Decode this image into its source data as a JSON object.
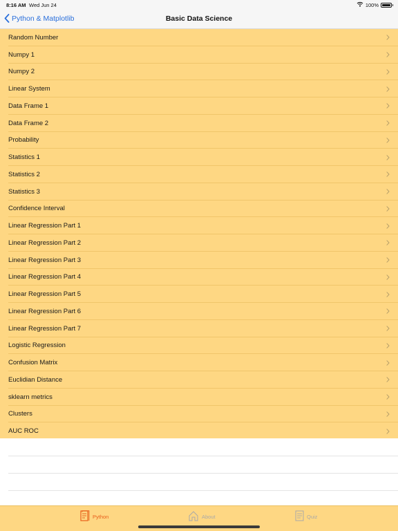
{
  "status_bar": {
    "time": "8:16 AM",
    "date": "Wed Jun 24",
    "battery": "100%",
    "battery_level": 1.0
  },
  "nav": {
    "back_label": "Python & Matplotlib",
    "title": "Basic Data Science"
  },
  "list": {
    "items": [
      {
        "label": "Random Number"
      },
      {
        "label": "Numpy 1"
      },
      {
        "label": "Numpy 2"
      },
      {
        "label": "Linear System"
      },
      {
        "label": "Data Frame 1"
      },
      {
        "label": "Data Frame 2"
      },
      {
        "label": "Probability"
      },
      {
        "label": "Statistics 1"
      },
      {
        "label": "Statistics 2"
      },
      {
        "label": "Statistics 3"
      },
      {
        "label": "Confidence Interval"
      },
      {
        "label": "Linear Regression Part 1"
      },
      {
        "label": "Linear Regression Part 2"
      },
      {
        "label": "Linear Regression Part 3"
      },
      {
        "label": "Linear Regression Part 4"
      },
      {
        "label": "Linear Regression Part 5"
      },
      {
        "label": "Linear Regression Part 6"
      },
      {
        "label": "Linear Regression Part 7"
      },
      {
        "label": "Logistic Regression"
      },
      {
        "label": "Confusion Matrix"
      },
      {
        "label": "Euclidian Distance"
      },
      {
        "label": "sklearn metrics"
      },
      {
        "label": "Clusters"
      },
      {
        "label": "AUC ROC"
      }
    ]
  },
  "tab_bar": {
    "tabs": [
      {
        "label": "Python",
        "icon": "document-icon",
        "active": true
      },
      {
        "label": "About",
        "icon": "home-icon",
        "active": false
      },
      {
        "label": "Quiz",
        "icon": "quiz-icon",
        "active": false
      }
    ]
  },
  "colors": {
    "list_background": "#fed783",
    "accent": "#e8601c",
    "link": "#2a6fdb"
  }
}
